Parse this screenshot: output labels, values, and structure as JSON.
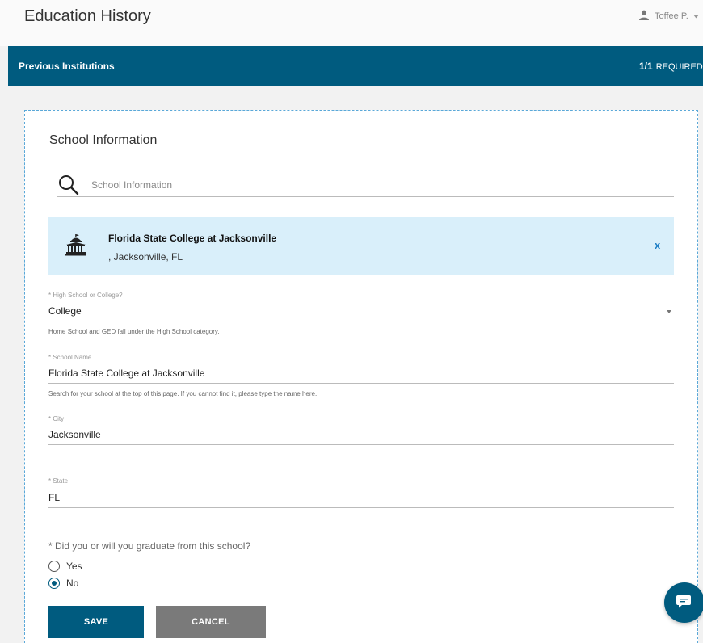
{
  "header": {
    "title": "Education History",
    "user_name": "Toffee P."
  },
  "section": {
    "title": "Previous Institutions",
    "progress": "1/1",
    "required_label": "REQUIRED"
  },
  "card": {
    "title": "School Information",
    "search": {
      "placeholder": "School Information",
      "value": ""
    },
    "selected_school": {
      "name": "Florida State College at Jacksonville",
      "location": ", Jacksonville, FL",
      "remove_label": "x"
    }
  },
  "form": {
    "school_type": {
      "label": "* High School or College?",
      "value": "College",
      "help": "Home School and GED fall under the High School category."
    },
    "school_name": {
      "label": "* School Name",
      "value": "Florida State College at Jacksonville",
      "help": "Search for your school at the top of this page. If you cannot find it, please type the name here."
    },
    "city": {
      "label": "* City",
      "value": "Jacksonville"
    },
    "state": {
      "label": "* State",
      "value": "FL"
    },
    "graduated": {
      "question": "* Did you or will you graduate from this school?",
      "options": [
        "Yes",
        "No"
      ],
      "selected": "No"
    }
  },
  "actions": {
    "save_label": "SAVE",
    "cancel_label": "CANCEL"
  },
  "colors": {
    "primary": "#005b7f",
    "selected_bg": "#d9effa",
    "dashed_border": "#5aa8d8",
    "cancel": "#7a7a7a",
    "link": "#1e7fc5"
  },
  "icons": {
    "user": "user-icon",
    "search": "search-icon",
    "school": "school-building-icon",
    "chevron": "chevron-down-icon",
    "chat": "chat-icon"
  }
}
